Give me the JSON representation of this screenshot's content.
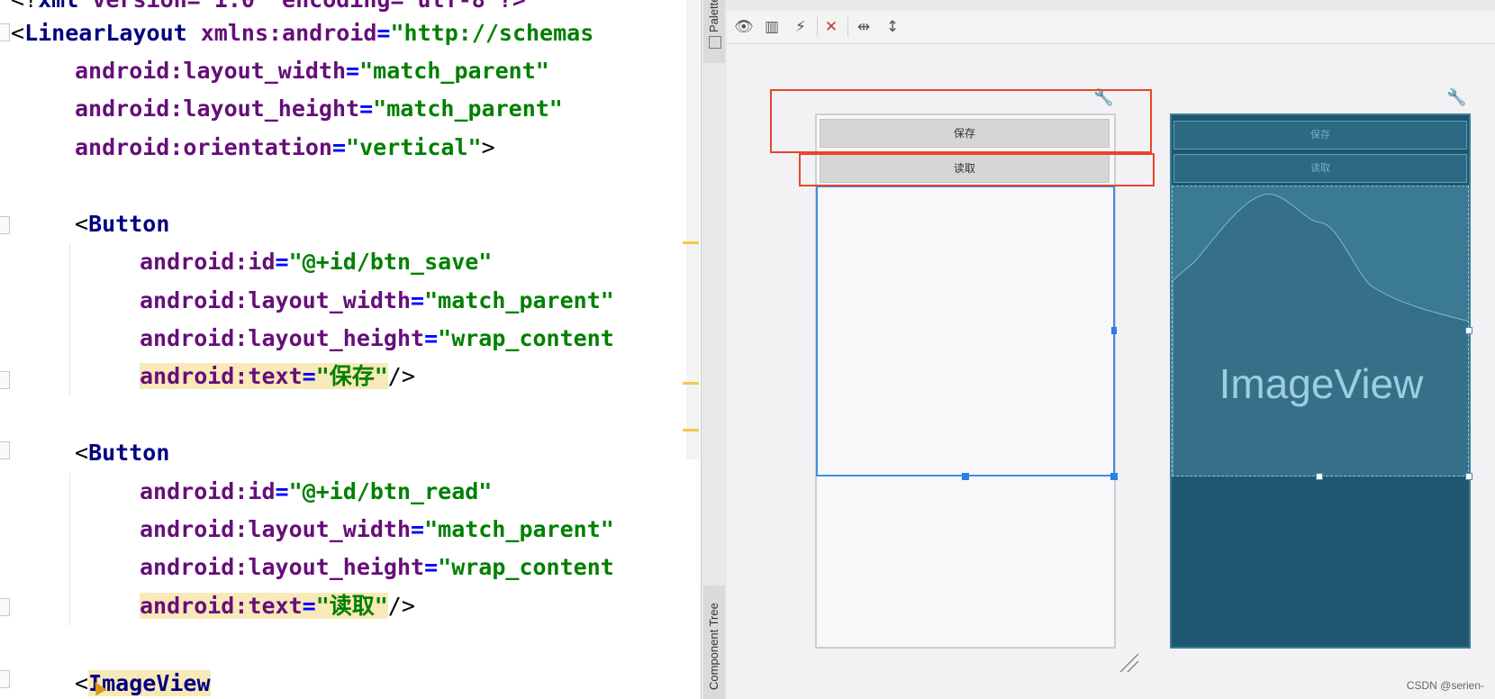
{
  "editor": {
    "lines": {
      "l0": {
        "prefix": "<?",
        "tag": "xml",
        "rest": " version=\"1.0\" encoding=\"utf-8\"?>"
      },
      "l1": {
        "open": "<",
        "tag": "LinearLayout",
        "attr": "xmlns:android",
        "eq": "=",
        "value": "\"http://schemas"
      },
      "l2": {
        "attr": "android:layout_width",
        "eq": "=",
        "value": "\"match_parent\""
      },
      "l3": {
        "attr": "android:layout_height",
        "eq": "=",
        "value": "\"match_parent\""
      },
      "l4": {
        "attr": "android:orientation",
        "eq": "=",
        "value": "\"vertical\"",
        "close": ">"
      },
      "l5": {
        "open": "<",
        "tag": "Button"
      },
      "l6": {
        "attr": "android:id",
        "eq": "=",
        "value": "\"@+id/btn_save\""
      },
      "l7": {
        "attr": "android:layout_width",
        "eq": "=",
        "value": "\"match_parent\""
      },
      "l8": {
        "attr": "android:layout_height",
        "eq": "=",
        "value": "\"wrap_content"
      },
      "l9": {
        "attr": "android:text",
        "eq": "=",
        "value": "\"保存\"",
        "close": "/>"
      },
      "l10": {
        "open": "<",
        "tag": "Button"
      },
      "l11": {
        "attr": "android:id",
        "eq": "=",
        "value": "\"@+id/btn_read\""
      },
      "l12": {
        "attr": "android:layout_width",
        "eq": "=",
        "value": "\"match_parent\""
      },
      "l13": {
        "attr": "android:layout_height",
        "eq": "=",
        "value": "\"wrap_content"
      },
      "l14": {
        "attr": "android:text",
        "eq": "=",
        "value": "\"读取\"",
        "close": "/>"
      },
      "l15": {
        "open": "<",
        "tag": "ImageView"
      }
    }
  },
  "side_tabs": {
    "palette": "Palette",
    "component_tree": "Component Tree"
  },
  "design": {
    "btn_save": "保存",
    "btn_read": "读取"
  },
  "blueprint": {
    "btn_save": "保存",
    "btn_read": "读取",
    "image_label": "ImageView"
  },
  "watermark": "CSDN @serien-",
  "colors": {
    "tag": "#000080",
    "attr": "#660e7a",
    "string": "#008000",
    "highlight": "#f8e9b9",
    "selection": "#3d8fe8",
    "annotation": "#e8452c",
    "blueprint_bg": "#1f5670"
  }
}
